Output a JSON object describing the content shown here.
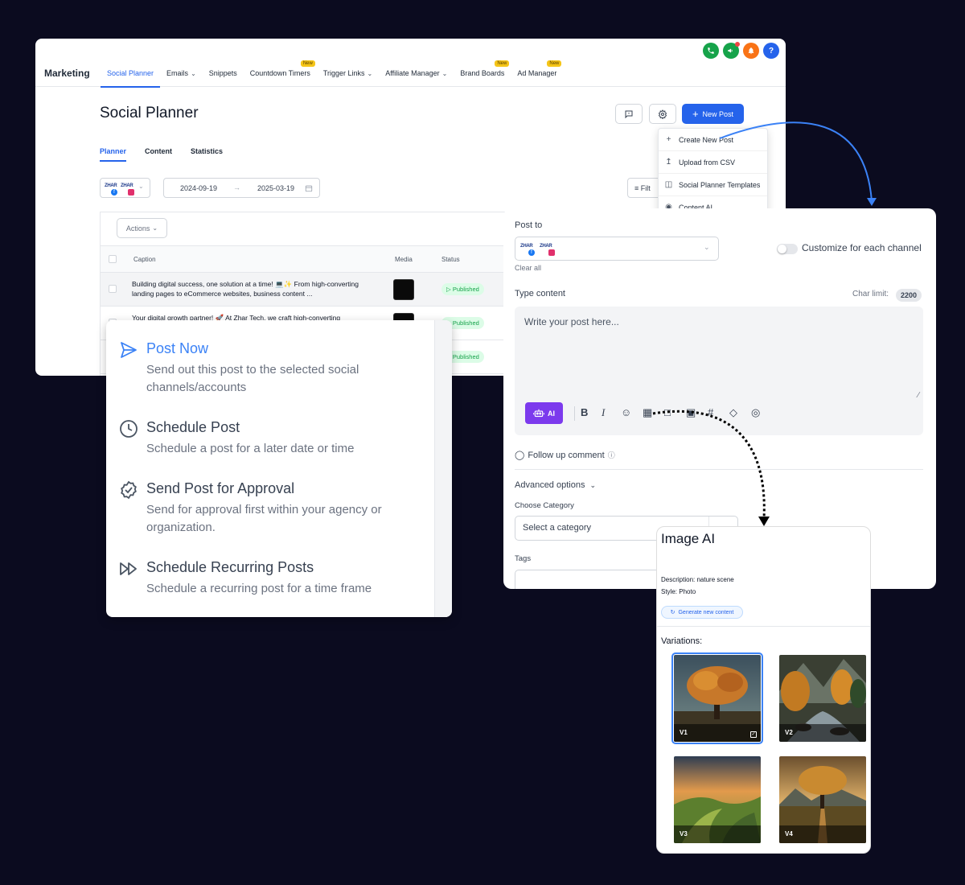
{
  "app": {
    "brand": "Marketing",
    "nav": [
      {
        "label": "Social Planner",
        "active": true
      },
      {
        "label": "Emails",
        "chevron": true
      },
      {
        "label": "Snippets"
      },
      {
        "label": "Countdown Timers",
        "badge": "New"
      },
      {
        "label": "Trigger Links",
        "chevron": true
      },
      {
        "label": "Affiliate Manager",
        "chevron": true
      },
      {
        "label": "Brand Boards",
        "badge": "New"
      },
      {
        "label": "Ad Manager",
        "badge": "New"
      }
    ],
    "topicons": [
      {
        "name": "phone-icon",
        "color": "#16a34a"
      },
      {
        "name": "megaphone-icon",
        "color": "#16a34a"
      },
      {
        "name": "bell-icon",
        "color": "#f97316"
      },
      {
        "name": "help-icon",
        "color": "#2563eb"
      }
    ],
    "help_glyph": "?",
    "page_title": "Social Planner",
    "new_post_label": "New Post",
    "tabs": [
      "Planner",
      "Content",
      "Statistics"
    ],
    "account_logo_text": "ZHAR",
    "date_from": "2024-09-19",
    "date_to": "2025-03-19",
    "filter_label": "Filt",
    "actions_label": "Actions",
    "columns": {
      "caption": "Caption",
      "media": "Media",
      "status": "Status"
    },
    "rows": [
      {
        "caption": "Building digital success, one solution at a time! 💻✨ From high-converting landing pages to eCommerce websites, business content ...",
        "status": "Published"
      },
      {
        "caption": "Your digital growth partner! 🚀 At Zhar Tech, we craft high-converting",
        "status": "Published"
      },
      {
        "caption": "",
        "status": "Published"
      }
    ],
    "dropdown": [
      {
        "icon": "plus-icon",
        "label": "Create New Post"
      },
      {
        "icon": "upload-icon",
        "label": "Upload from CSV"
      },
      {
        "icon": "template-icon",
        "label": "Social Planner Templates"
      },
      {
        "icon": "ai-icon",
        "label": "Content AI"
      }
    ]
  },
  "composer": {
    "post_to_label": "Post to",
    "account_logo_text": "ZHAR",
    "clear_all": "Clear all",
    "customize_label": "Customize for each channel",
    "type_content_label": "Type content",
    "char_limit_label": "Char limit:",
    "char_limit_value": "2200",
    "placeholder": "Write your post here...",
    "ai_label": "AI",
    "follow_up_label": "Follow up comment",
    "advanced_label": "Advanced options",
    "category_label": "Choose Category",
    "category_placeholder": "Select a category",
    "tags_label": "Tags"
  },
  "post_options": [
    {
      "icon": "send-icon",
      "title": "Post Now",
      "desc": "Send out this post to the selected social channels/accounts",
      "highlight": true
    },
    {
      "icon": "clock-icon",
      "title": "Schedule Post",
      "desc": "Schedule a post for a later date or time"
    },
    {
      "icon": "badge-check-icon",
      "title": "Send Post for Approval",
      "desc": "Send for approval first within your agency or organization."
    },
    {
      "icon": "recurring-icon",
      "title": "Schedule Recurring Posts",
      "desc": "Schedule a recurring post for a time frame"
    }
  ],
  "image_ai": {
    "title": "Image AI",
    "description_label": "Description:",
    "description_value": "nature scene",
    "style_label": "Style:",
    "style_value": "Photo",
    "generate_label": "Generate new content",
    "variations_label": "Variations:",
    "variations": [
      {
        "label": "V1",
        "selected": true
      },
      {
        "label": "V2",
        "selected": false
      },
      {
        "label": "V3",
        "selected": false
      },
      {
        "label": "V4",
        "selected": false
      }
    ]
  },
  "colors": {
    "accent": "#2563eb",
    "ai": "#7c3aed",
    "published_bg": "#dcfce7",
    "published_text": "#16a34a",
    "background": "#0b0b1f"
  }
}
